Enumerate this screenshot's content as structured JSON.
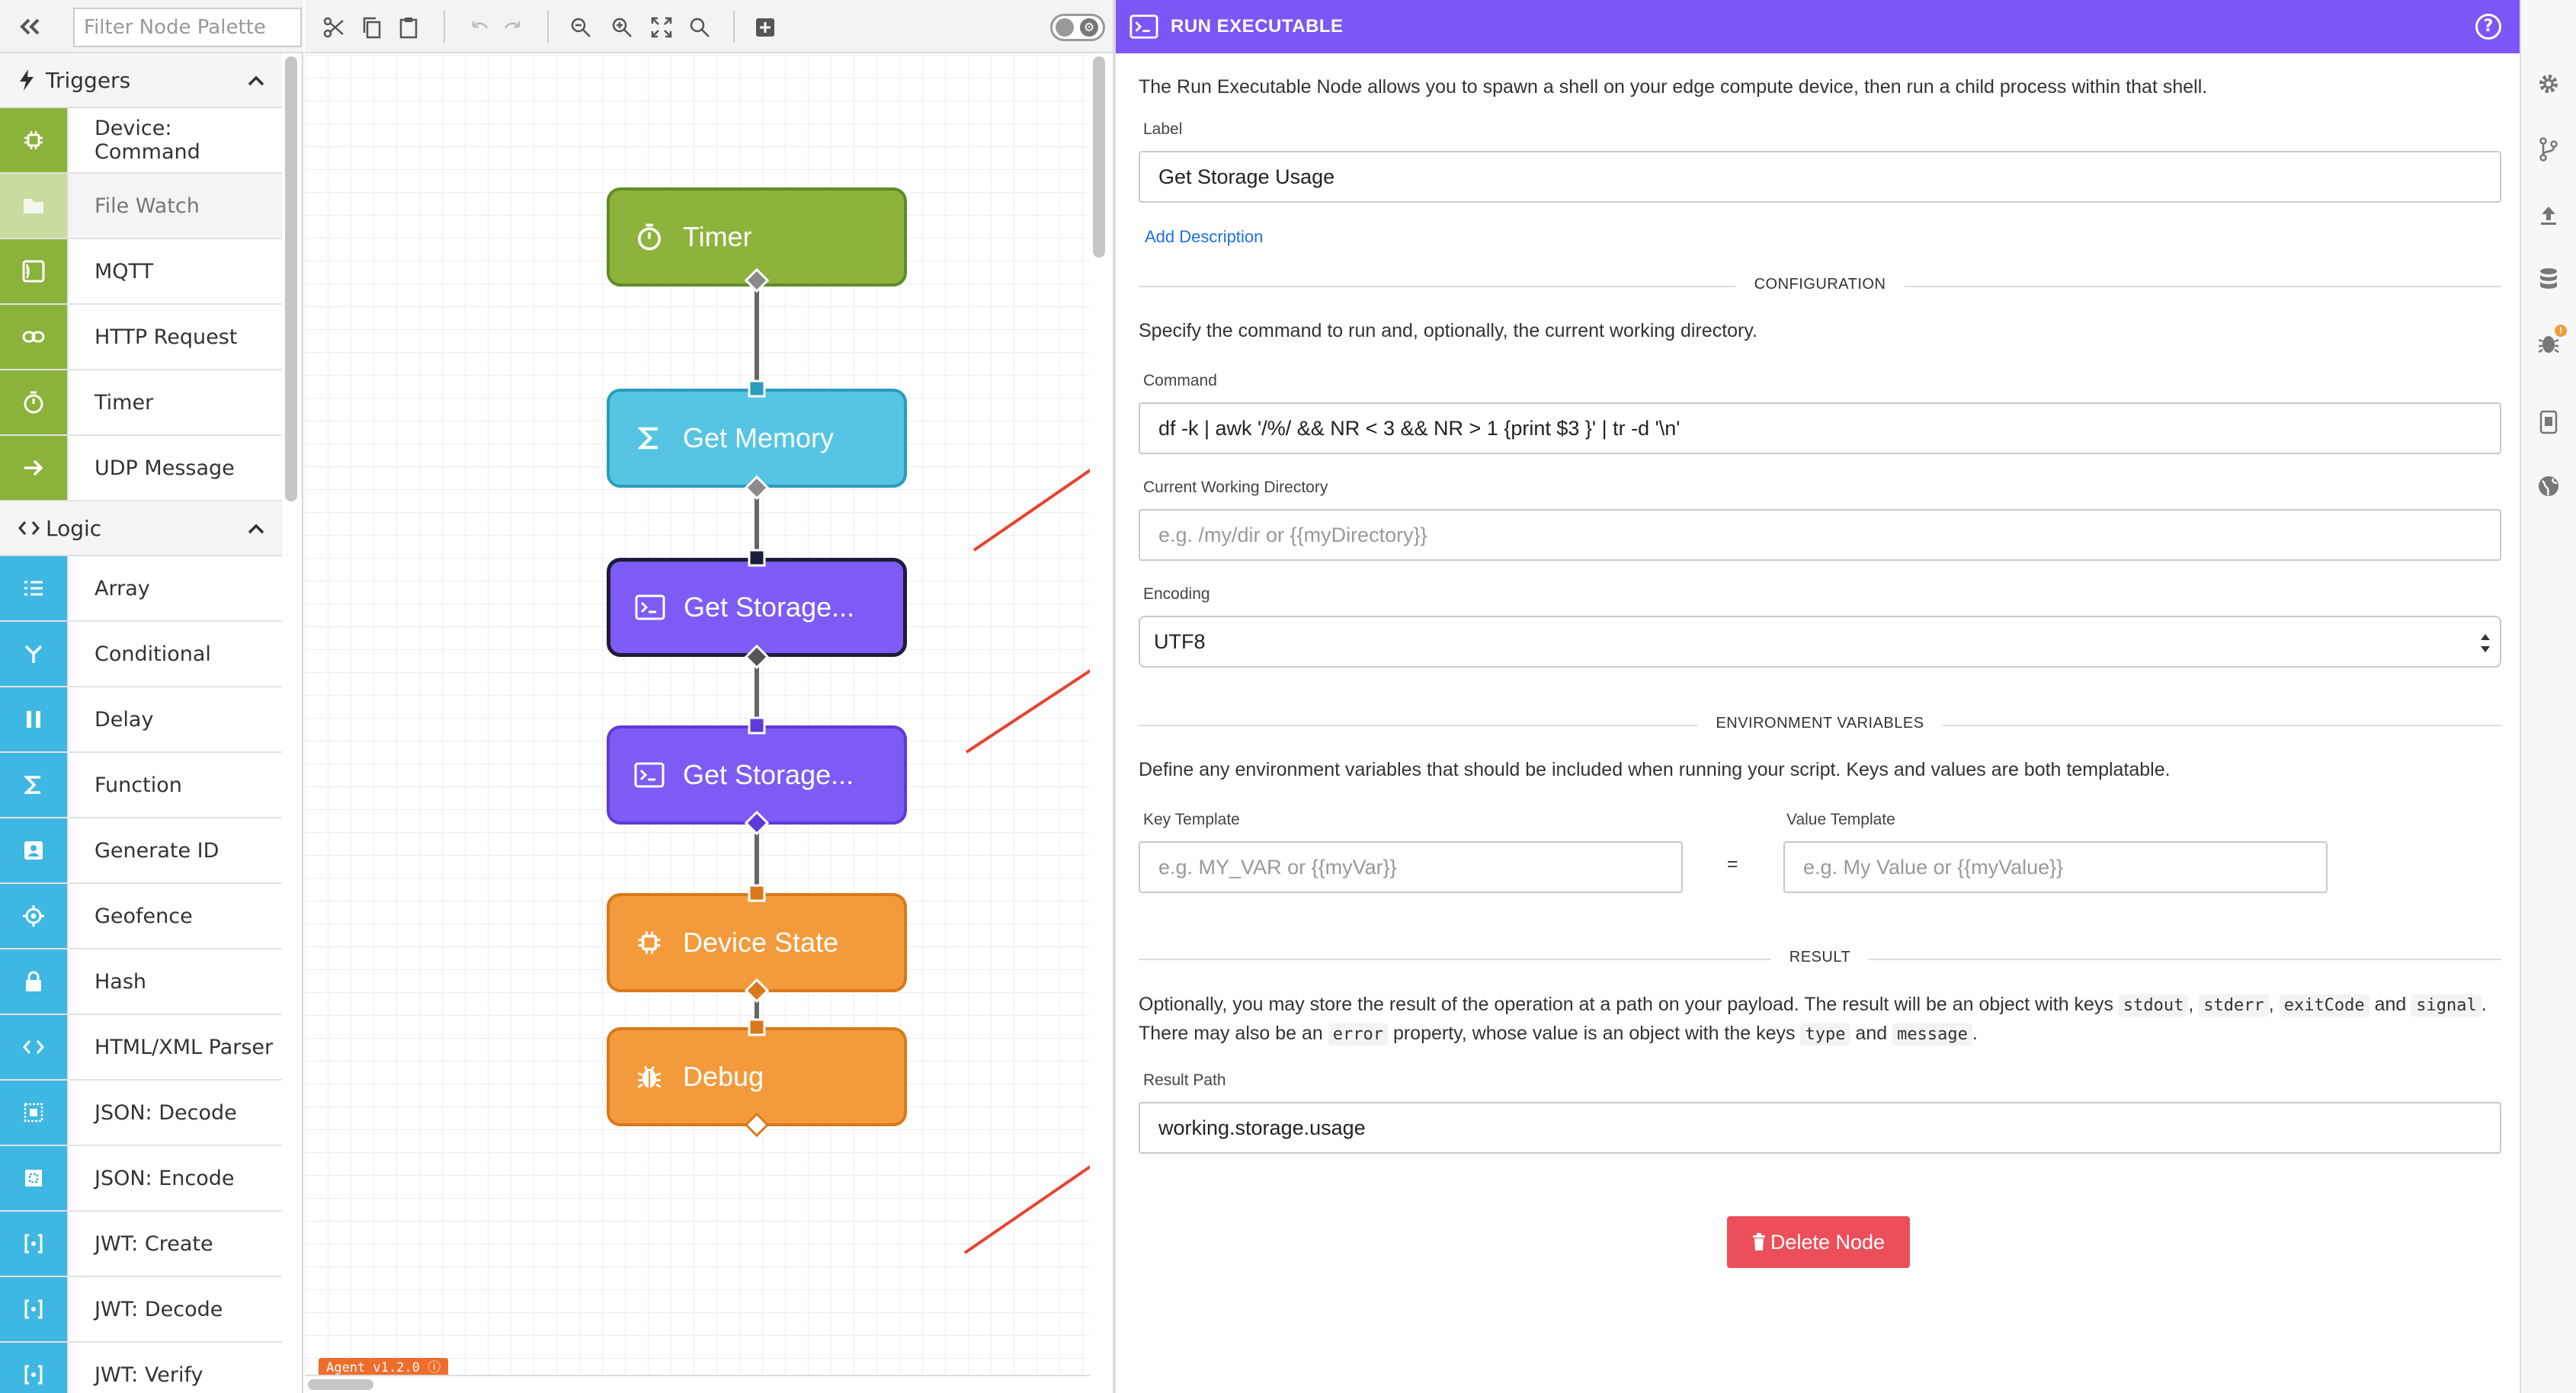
{
  "palette": {
    "filter_placeholder": "Filter Node Palette",
    "sections": [
      {
        "name": "Triggers",
        "items": [
          {
            "label": "Device: Command",
            "icon": "chip-icon"
          },
          {
            "label": "File Watch",
            "icon": "folder-icon",
            "disabled": true
          },
          {
            "label": "MQTT",
            "icon": "mqtt-icon"
          },
          {
            "label": "HTTP Request",
            "icon": "link-icon"
          },
          {
            "label": "Timer",
            "icon": "stopwatch-icon"
          },
          {
            "label": "UDP Message",
            "icon": "arrow-right-icon"
          }
        ]
      },
      {
        "name": "Logic",
        "items": [
          {
            "label": "Array",
            "icon": "list-icon"
          },
          {
            "label": "Conditional",
            "icon": "branch-icon"
          },
          {
            "label": "Delay",
            "icon": "pause-icon"
          },
          {
            "label": "Function",
            "icon": "sigma-icon"
          },
          {
            "label": "Generate ID",
            "icon": "id-card-icon"
          },
          {
            "label": "Geofence",
            "icon": "crosshair-icon"
          },
          {
            "label": "Hash",
            "icon": "lock-icon"
          },
          {
            "label": "HTML/XML Parser",
            "icon": "code-icon"
          },
          {
            "label": "JSON: Decode",
            "icon": "json-decode-icon"
          },
          {
            "label": "JSON: Encode",
            "icon": "json-encode-icon"
          },
          {
            "label": "JWT: Create",
            "icon": "jwt-icon"
          },
          {
            "label": "JWT: Decode",
            "icon": "jwt-icon"
          },
          {
            "label": "JWT: Verify",
            "icon": "jwt-icon"
          }
        ]
      }
    ]
  },
  "canvas": {
    "nodes": [
      {
        "label": "Timer",
        "color": "green",
        "icon": "stopwatch-icon"
      },
      {
        "label": "Get Memory",
        "color": "blue",
        "icon": "sigma-icon"
      },
      {
        "label": "Get Storage...",
        "color": "purple",
        "icon": "terminal-icon",
        "selected": true
      },
      {
        "label": "Get Storage...",
        "color": "purple",
        "icon": "terminal-icon"
      },
      {
        "label": "Device State",
        "color": "orange",
        "icon": "chip-icon"
      },
      {
        "label": "Debug",
        "color": "orange",
        "icon": "bug-icon"
      }
    ],
    "agent_version": "Agent v1.2.0"
  },
  "panel": {
    "title": "RUN EXECUTABLE",
    "description": "The Run Executable Node allows you to spawn a shell on your edge compute device, then run a child process within that shell.",
    "label_field": {
      "label": "Label",
      "value": "Get Storage Usage"
    },
    "add_description": "Add Description",
    "configuration": {
      "heading": "CONFIGURATION",
      "intro": "Specify the command to run and, optionally, the current working directory.",
      "command_label": "Command",
      "command_value": "df -k | awk '/%/ && NR < 3 && NR > 1 {print $3 }' | tr -d '\\n'",
      "cwd_label": "Current Working Directory",
      "cwd_placeholder": "e.g. /my/dir or {{myDirectory}}",
      "encoding_label": "Encoding",
      "encoding_value": "UTF8"
    },
    "environment": {
      "heading": "ENVIRONMENT VARIABLES",
      "intro": "Define any environment variables that should be included when running your script. Keys and values are both templatable.",
      "key_label": "Key Template",
      "key_placeholder": "e.g. MY_VAR or {{myVar}}",
      "equals": "=",
      "value_label": "Value Template",
      "value_placeholder": "e.g. My Value or {{myValue}}"
    },
    "result": {
      "heading": "RESULT",
      "intro_a": "Optionally, you may store the result of the operation at a path on your payload. The result will be an object with keys",
      "code_stdout": "stdout",
      "sep1": ",",
      "code_stderr": "stderr",
      "sep2": ",",
      "code_exitcode": "exitCode",
      "intro_b": "and",
      "code_signal": "signal",
      "intro_c": ". There may also be an",
      "code_error": "error",
      "intro_d": "property, whose value is an object with the keys",
      "code_type": "type",
      "intro_e": "and",
      "code_message": "message",
      "intro_f": ".",
      "path_label": "Result Path",
      "path_value": "working.storage.usage"
    },
    "delete_label": "Delete Node"
  },
  "colors": {
    "accent": "#7b57f5",
    "trigger": "#8bb23a",
    "logic": "#3eb7e2",
    "danger": "#ec4f5a",
    "annotation_arrow": "#e8432f"
  }
}
